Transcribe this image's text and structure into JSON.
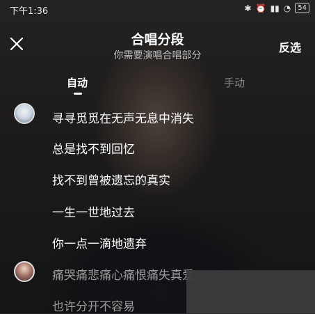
{
  "status_bar": {
    "time": "下午1:36",
    "icons": [
      "alarm-icon",
      "bluetooth-icon",
      "signal-icon",
      "wifi-icon"
    ],
    "battery": "54"
  },
  "header": {
    "title": "合唱分段",
    "subtitle": "你需要演唱合唱部分",
    "invert_label": "反选"
  },
  "tabs": [
    {
      "label": "自动",
      "active": true
    },
    {
      "label": "手动",
      "active": false
    }
  ],
  "lyrics": [
    {
      "text": "寻寻觅觅在无声无息中消失",
      "avatar": "singer-a"
    },
    {
      "text": "总是找不到回忆"
    },
    {
      "text": "找不到曾被遗忘的真实"
    },
    {
      "text": "一生一世地过去"
    },
    {
      "text": "你一点一滴地遗弃"
    },
    {
      "text": "痛哭痛悲痛心痛恨痛失真爱",
      "avatar": "singer-b",
      "dim": true
    },
    {
      "text": "也许分开不容易",
      "dim": true
    }
  ],
  "colors": {
    "accent": "#ffffff",
    "inactive_tab": "#8a8a8a",
    "dim_lyric": "#9a9a9a"
  }
}
